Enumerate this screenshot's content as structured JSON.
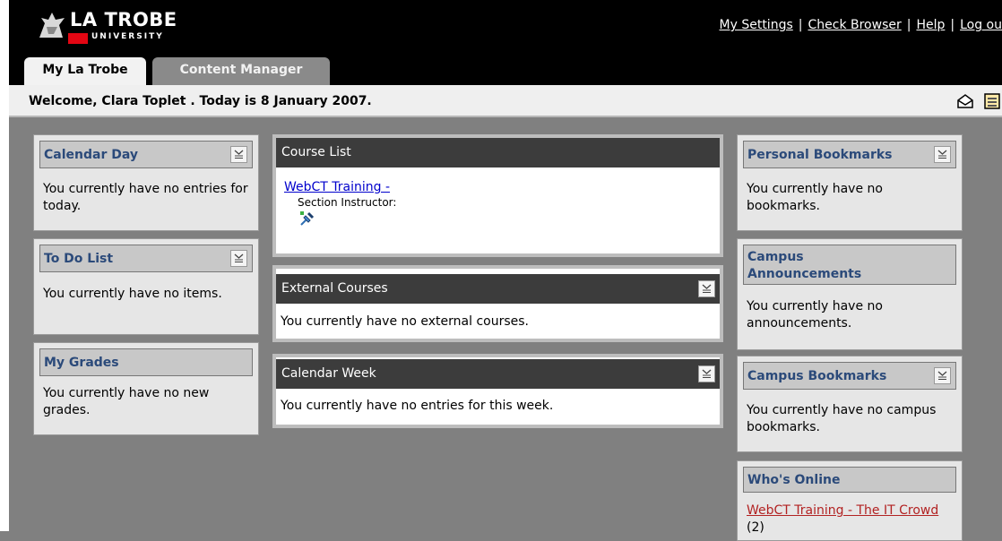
{
  "brand": {
    "name": "LA TROBE",
    "sub": "UNIVERSITY"
  },
  "top_links": [
    "My Settings",
    "Check Browser",
    "Help",
    "Log ou"
  ],
  "tabs": [
    "My La Trobe",
    "Content Manager"
  ],
  "welcome": "Welcome, Clara Toplet . Today is 8 January 2007.",
  "icons": [
    "mail-icon",
    "calendar-icon",
    "minimize-icon",
    "pushpin-icon"
  ],
  "colors": {
    "header_text": "#2b4a7a",
    "dark_header": "#3c3c3c",
    "logo_red": "#e30613",
    "background": "#808080"
  },
  "left": {
    "calendar_day": {
      "title": "Calendar Day",
      "text": "You currently have no entries for today."
    },
    "todo": {
      "title": "To Do List",
      "text": "You currently have no items."
    },
    "grades": {
      "title": "My Grades",
      "text": "You currently have no new grades."
    }
  },
  "center": {
    "course_list": {
      "title": "Course List",
      "course_link": "WebCT Training -",
      "instructor_label": "Section Instructor:"
    },
    "external": {
      "title": "External Courses",
      "text": "You currently have no external courses."
    },
    "calendar_week": {
      "title": "Calendar Week",
      "text": "You currently have no entries for this week."
    }
  },
  "right": {
    "personal_bookmarks": {
      "title": "Personal Bookmarks",
      "text": "You currently have no bookmarks."
    },
    "campus_announcements": {
      "title": "Campus Announcements",
      "text": "You currently have no announcements."
    },
    "campus_bookmarks": {
      "title": "Campus Bookmarks",
      "text": "You currently have no campus bookmarks."
    },
    "whos_online": {
      "title": "Who's Online",
      "link": "WebCT Training - The IT Crowd",
      "count": "(2)"
    }
  }
}
